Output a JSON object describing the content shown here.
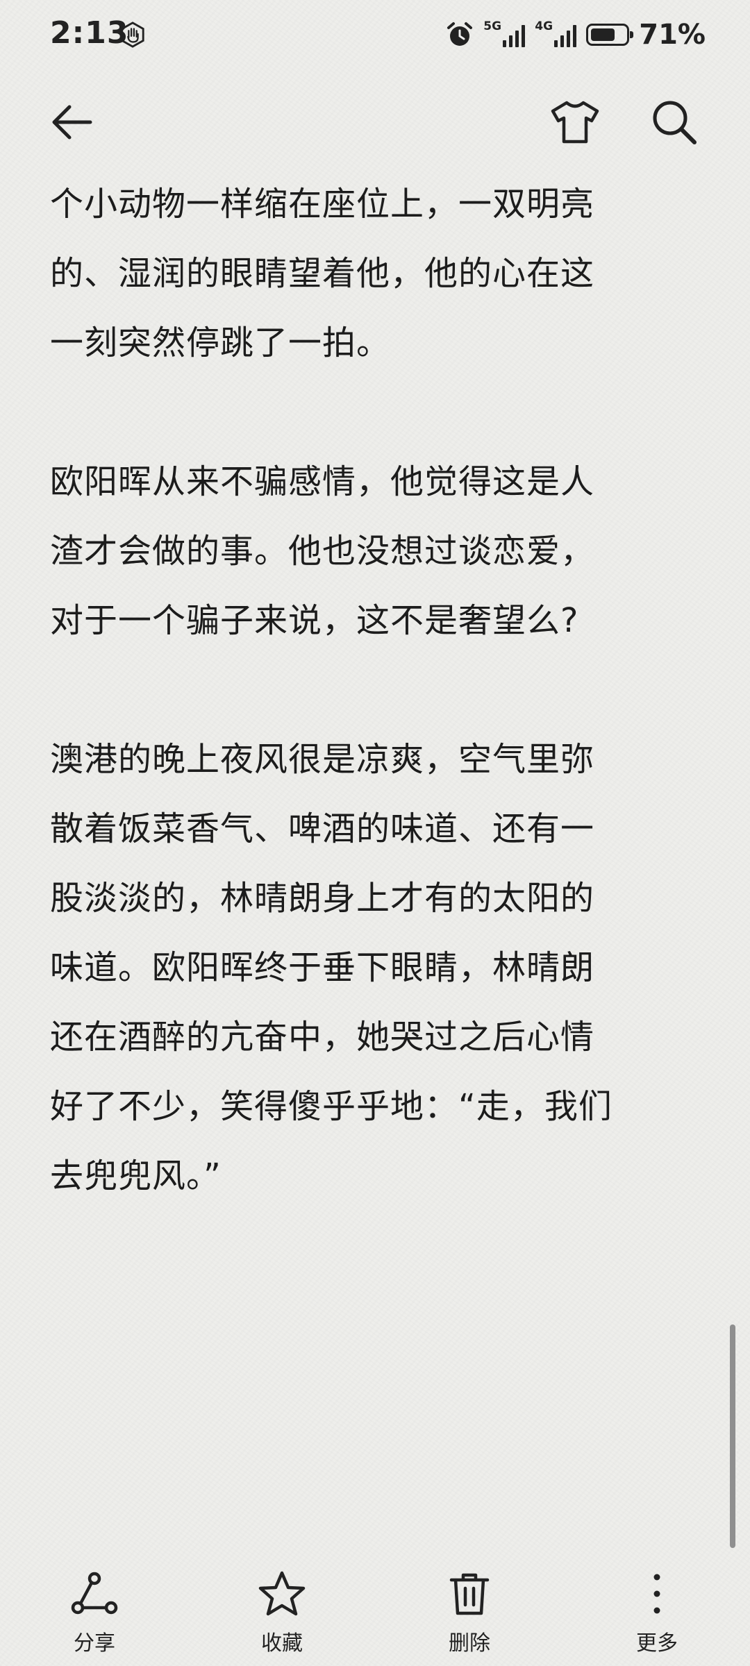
{
  "status_bar": {
    "time": "2:13",
    "network_1": "5G",
    "network_2": "4G",
    "battery_percent": "71%",
    "battery_level": 0.71,
    "icons": [
      "hand-icon",
      "alarm-icon",
      "signal-icon",
      "battery-icon"
    ]
  },
  "top_bar": {
    "icons": [
      "back-arrow-icon",
      "shirt-icon",
      "search-icon"
    ]
  },
  "article": {
    "paragraphs": [
      "个小动物一样缩在座位上，一双明亮\n的、湿润的眼睛望着他，他的心在这\n一刻突然停跳了一拍。",
      "欧阳晖从来不骗感情，他觉得这是人\n渣才会做的事。他也没想过谈恋爱，\n对于一个骗子来说，这不是奢望么?",
      "澳港的晚上夜风很是凉爽，空气里弥\n散着饭菜香气、啤酒的味道、还有一\n股淡淡的，林晴朗身上才有的太阳的\n味道。欧阳晖终于垂下眼睛，林晴朗\n还在酒醉的亢奋中，她哭过之后心情\n好了不少，笑得傻乎乎地：“走，我们\n去兜兜风。”"
    ]
  },
  "toolbar": {
    "share_label": "分享",
    "favorite_label": "收藏",
    "delete_label": "删除",
    "more_label": "更多"
  },
  "colors": {
    "background": "#eeeeeb",
    "text": "#1c1c1c",
    "scrollbar": "#8f8f8f"
  }
}
